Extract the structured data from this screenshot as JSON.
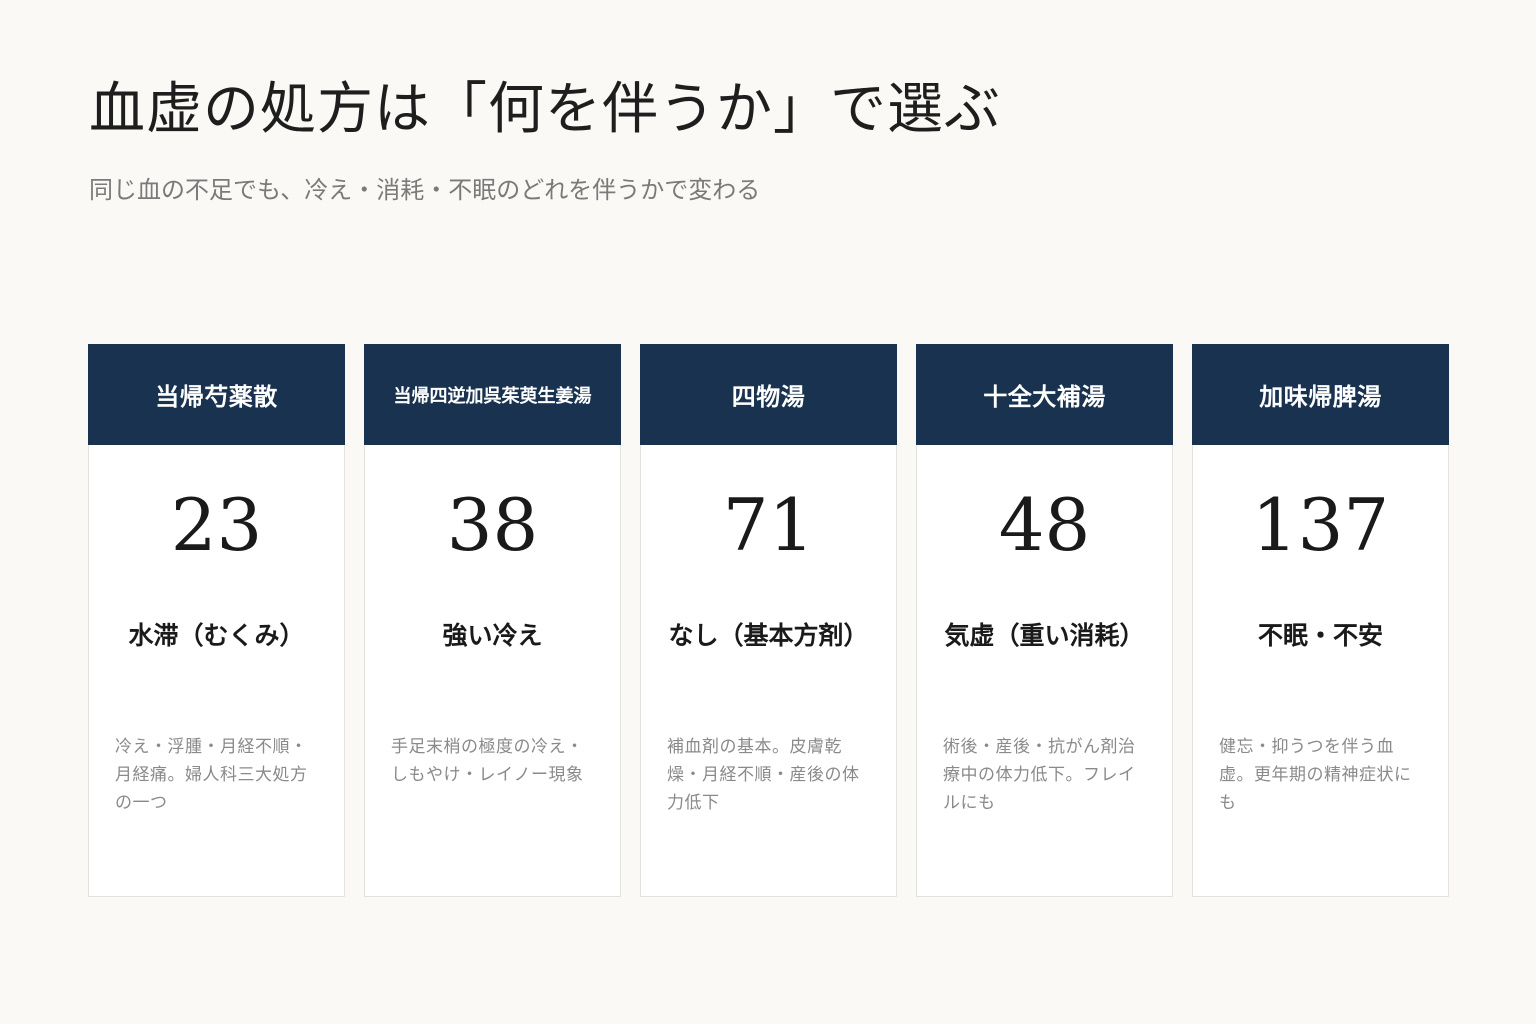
{
  "header": {
    "title": "血虚の処方は「何を伴うか」で選ぶ",
    "subtitle": "同じ血の不足でも、冷え・消耗・不眠のどれを伴うかで変わる"
  },
  "cards": [
    {
      "name": "当帰芍薬散",
      "number": "23",
      "label": "水滞（むくみ）",
      "description": "冷え・浮腫・月経不順・月経痛。婦人科三大処方の一つ"
    },
    {
      "name": "当帰四逆加呉茱萸生姜湯",
      "number": "38",
      "label": "強い冷え",
      "description": "手足末梢の極度の冷え・しもやけ・レイノー現象"
    },
    {
      "name": "四物湯",
      "number": "71",
      "label": "なし（基本方剤）",
      "description": "補血剤の基本。皮膚乾燥・月経不順・産後の体力低下"
    },
    {
      "name": "十全大補湯",
      "number": "48",
      "label": "気虚（重い消耗）",
      "description": "術後・産後・抗がん剤治療中の体力低下。フレイルにも"
    },
    {
      "name": "加味帰脾湯",
      "number": "137",
      "label": "不眠・不安",
      "description": "健忘・抑うつを伴う血虚。更年期の精神症状にも"
    }
  ],
  "colors": {
    "header_bg": "#193250",
    "page_bg": "#faf9f6"
  }
}
